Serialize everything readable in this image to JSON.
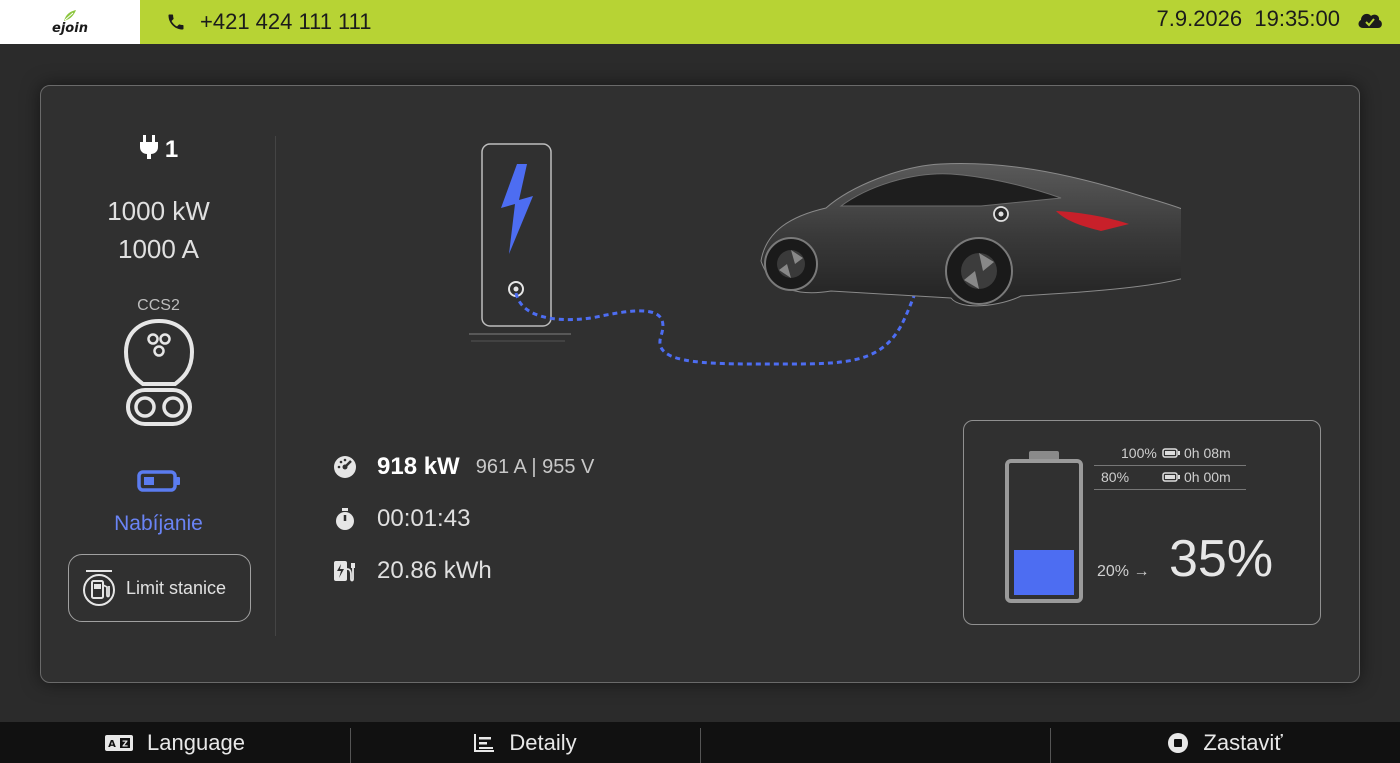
{
  "header": {
    "logo_text": "ejoin",
    "phone": "+421 424 111 111",
    "datetime": "7.9.2026  19:35:00",
    "cloud_icon": "cloud-icon",
    "accent_color": "#b7d334"
  },
  "connector": {
    "number": "1",
    "power": "1000 kW",
    "current": "1000 A",
    "type": "CCS2",
    "status": "Nabíjanie",
    "status_color": "#6a84f5",
    "limit_button": "Limit stanice"
  },
  "session": {
    "power": "918 kW",
    "current_voltage": "961 A | 955 V",
    "duration": "00:01:43",
    "energy": "20.86 kWh"
  },
  "battery": {
    "levels": [
      {
        "pct": "100%",
        "time": "0h 08m"
      },
      {
        "pct": "80%",
        "time": "0h 00m"
      }
    ],
    "soc_start": "20% →",
    "soc_current": "35%",
    "fill_fraction": 0.35
  },
  "bottom": {
    "language": "Language",
    "detail": "Detaily",
    "empty": "",
    "stop": "Zastaviť"
  }
}
